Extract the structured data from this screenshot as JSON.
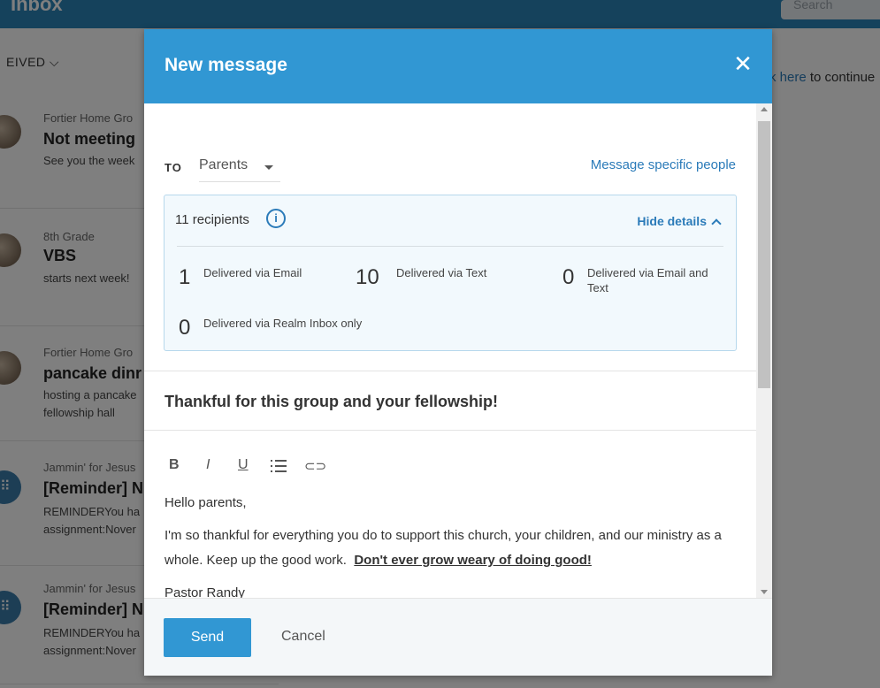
{
  "background": {
    "app_title": "Inbox",
    "search_placeholder": "Search",
    "filter_label": "EIVED",
    "right_text_link": "k here",
    "right_text_rest": " to continue",
    "messages": [
      {
        "group": "Fortier Home Gro",
        "subject": "Not meeting",
        "preview": [
          "See you the week"
        ]
      },
      {
        "group": "8th Grade",
        "subject": "VBS",
        "preview": [
          "starts next week!"
        ]
      },
      {
        "group": "Fortier Home Gro",
        "subject": "pancake dinr",
        "preview": [
          "hosting a pancake",
          "fellowship hall"
        ]
      },
      {
        "group": "Jammin' for Jesus",
        "subject": "[Reminder] N",
        "preview": [
          "REMINDERYou ha",
          "assignment:Nover"
        ]
      },
      {
        "group": "Jammin' for Jesus",
        "subject": "[Reminder] N",
        "preview": [
          "REMINDERYou ha",
          "assignment:Nover"
        ]
      }
    ]
  },
  "modal": {
    "title": "New message",
    "to_label": "TO",
    "to_value": "Parents",
    "specific_link": "Message specific people",
    "recipients": {
      "count_label": "11 recipients",
      "info_glyph": "i",
      "hide_details": "Hide details",
      "stats": [
        {
          "count": "1",
          "label": "Delivered via Email"
        },
        {
          "count": "10",
          "label": "Delivered via Text"
        },
        {
          "count": "0",
          "label": "Delivered via Email and Text"
        },
        {
          "count": "0",
          "label": "Delivered via Realm Inbox only"
        }
      ]
    },
    "subject": "Thankful for this group and your fellowship!",
    "toolbar": {
      "bold": "B",
      "italic": "I",
      "underline": "U",
      "link_glyph": "⊂⊃"
    },
    "body": {
      "greeting": "Hello parents,",
      "paragraph": "I'm so thankful for everything you do to support this church, your children, and our ministry as a whole.  Keep up the good work.",
      "emphasis": "Don't ever grow weary of doing good!",
      "signature": "Pastor Randy"
    },
    "send_label": "Send",
    "cancel_label": "Cancel"
  },
  "colors": {
    "header": "#3197d3",
    "link": "#2b7bb9",
    "recipients_bg": "#f2f9fd"
  }
}
